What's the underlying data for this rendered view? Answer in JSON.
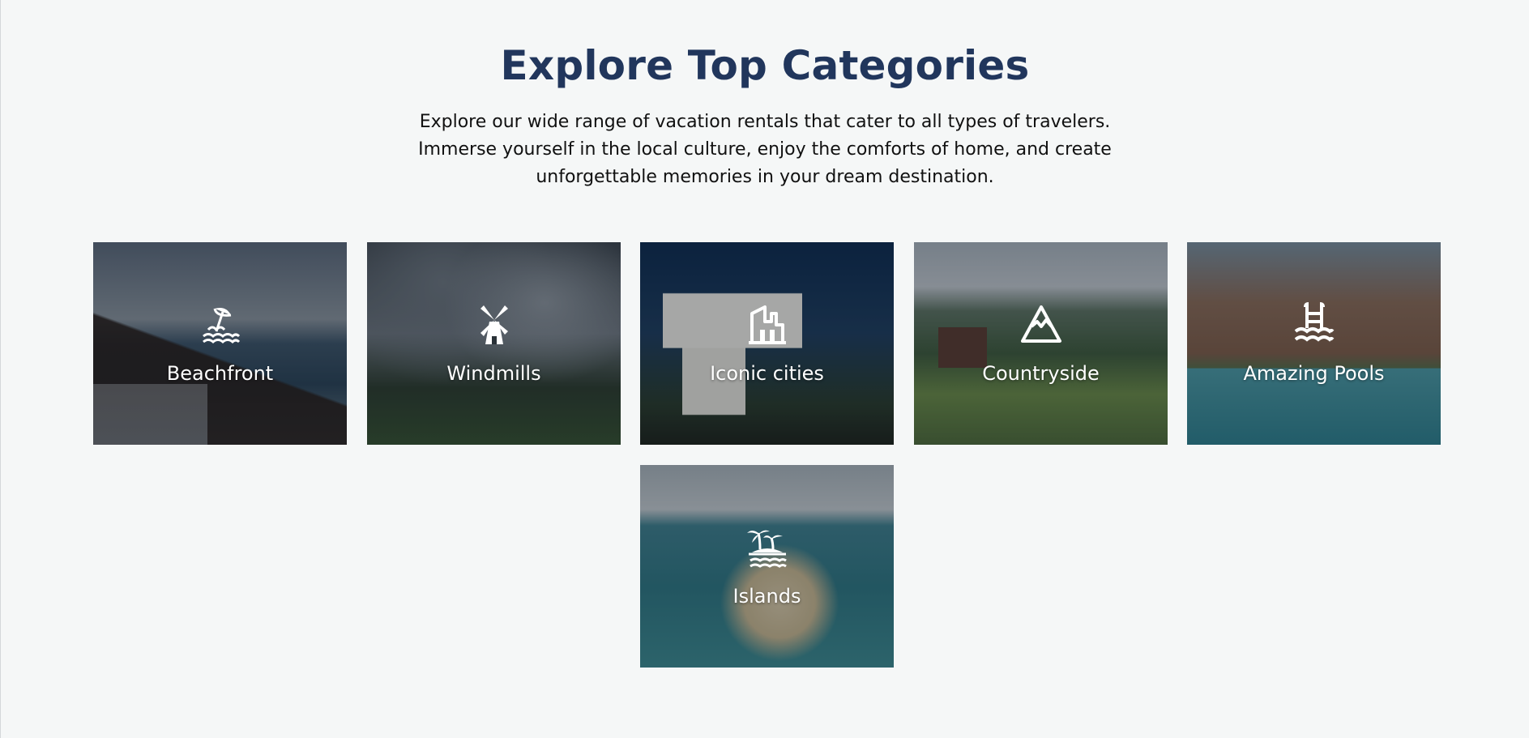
{
  "heading": "Explore Top Categories",
  "description": [
    "Explore our wide range of vacation rentals that cater to all types of travelers.",
    "Immerse yourself in the local culture, enjoy the comforts of home, and create",
    "unforgettable memories in your dream destination."
  ],
  "colors": {
    "background": "#f5f7f7",
    "heading": "#21365c",
    "label": "#ffffff"
  },
  "categories": [
    {
      "label": "Beachfront",
      "icon": "beach-umbrella-icon"
    },
    {
      "label": "Windmills",
      "icon": "windmill-icon"
    },
    {
      "label": "Iconic cities",
      "icon": "city-buildings-icon"
    },
    {
      "label": "Countryside",
      "icon": "mountain-icon"
    },
    {
      "label": "Amazing Pools",
      "icon": "pool-ladder-icon"
    },
    {
      "label": "Islands",
      "icon": "palm-island-icon"
    }
  ]
}
